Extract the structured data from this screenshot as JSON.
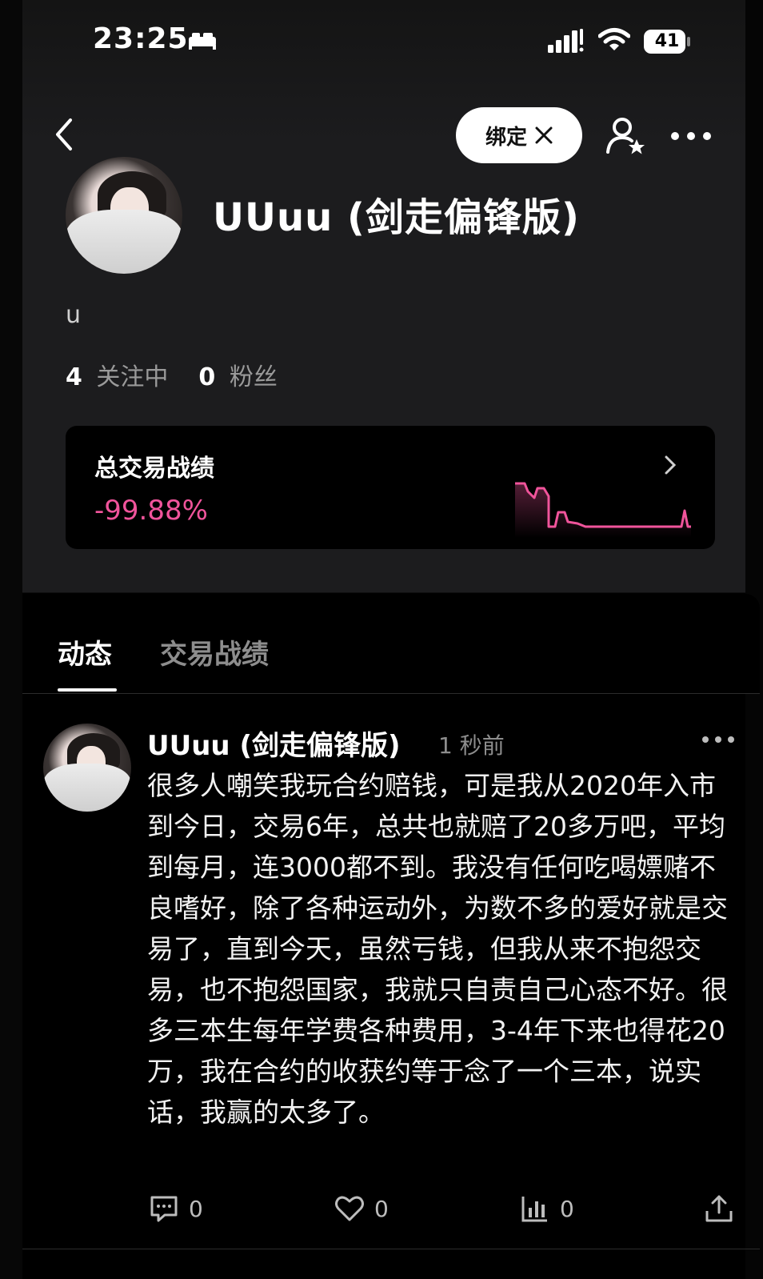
{
  "status_bar": {
    "time": "23:25",
    "battery": "41"
  },
  "header": {
    "bind_label": "绑定"
  },
  "profile": {
    "name": "UUuu (剑走偏锋版)",
    "bio": "u",
    "following_count": "4",
    "following_label": "关注中",
    "followers_count": "0",
    "followers_label": "粉丝"
  },
  "performance": {
    "title": "总交易战绩",
    "value": "-99.88%",
    "accent_color": "#f0549b"
  },
  "tabs": [
    {
      "label": "动态",
      "active": true
    },
    {
      "label": "交易战绩",
      "active": false
    }
  ],
  "post": {
    "author": "UUuu (剑走偏锋版)",
    "time": "1 秒前",
    "text": "很多人嘲笑我玩合约赔钱，可是我从2020年入市到今日，交易6年，总共也就赔了20多万吧，平均到每月，连3000都不到。我没有任何吃喝嫖赌不良嗜好，除了各种运动外，为数不多的爱好就是交易了，直到今天，虽然亏钱，但我从来不抱怨交易，也不抱怨国家，我就只自责自己心态不好。很多三本生每年学费各种费用，3-4年下来也得花20万，我在合约的收获约等于念了一个三本，说实话，我赢的太多了。",
    "comments": "0",
    "likes": "0",
    "views": "0"
  },
  "icons": [
    "back-icon",
    "x-logo-icon",
    "follow-user-icon",
    "more-icon",
    "chevron-right-icon",
    "comment-icon",
    "heart-icon",
    "stats-icon",
    "share-icon",
    "signal-icon",
    "wifi-icon",
    "battery-icon",
    "bed-icon"
  ]
}
